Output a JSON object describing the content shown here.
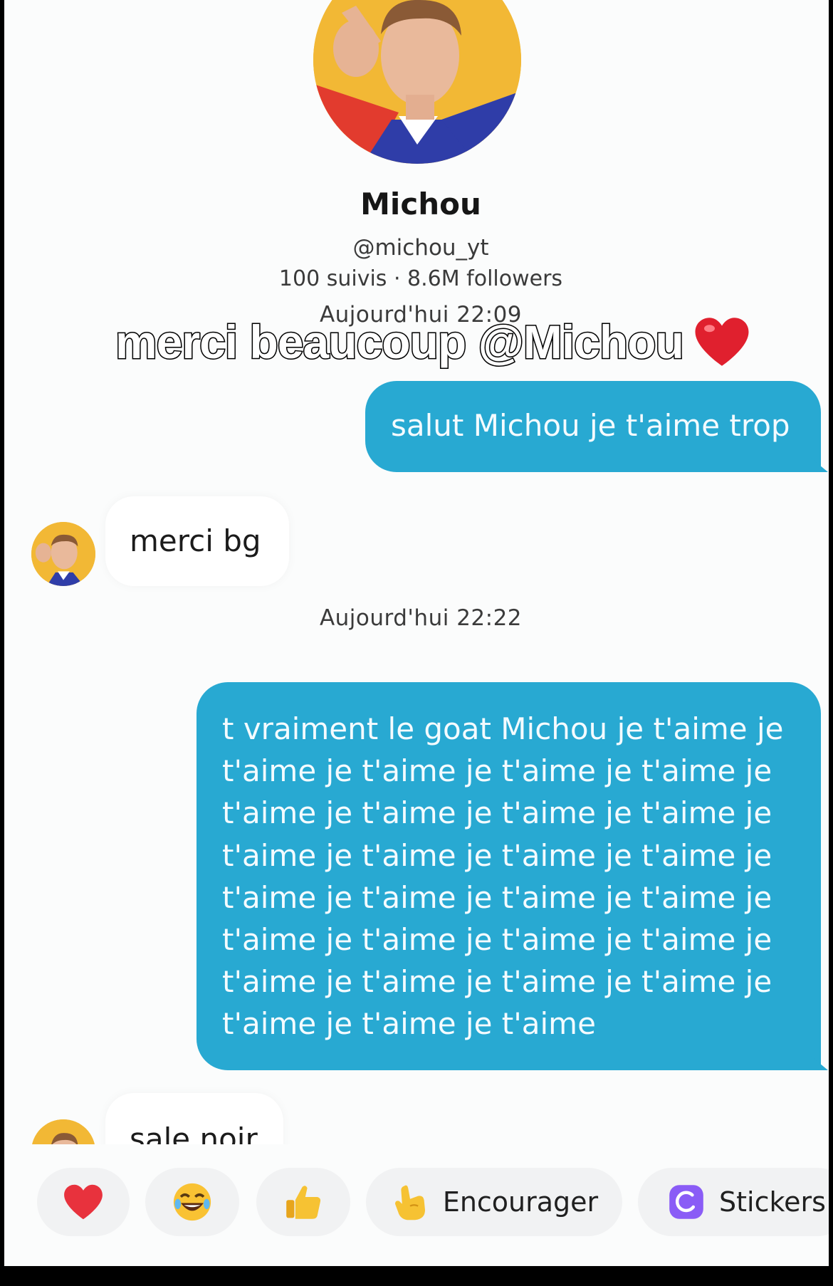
{
  "profile": {
    "name": "Michou",
    "handle": "@michou_yt",
    "stats": "100 suivis · 8.6M followers"
  },
  "overlay_caption": "merci beaucoup @Michou",
  "conversation": {
    "timestamp_1": "Aujourd'hui 22:09",
    "timestamp_2": "Aujourd'hui 22:22",
    "messages": [
      {
        "side": "sent",
        "text": "salut Michou je t'aime trop"
      },
      {
        "side": "received",
        "text": "merci bg"
      },
      {
        "side": "sent",
        "text": "t vraiment le goat Michou je t'aime je t'aime je t'aime je t'aime je t'aime je t'aime je t'aime je t'aime je t'aime je t'aime je t'aime je t'aime je t'aime je t'aime je t'aime je t'aime je t'aime je t'aime je t'aime je t'aime je t'aime je t'aime je t'aime je t'aime je t'aime je t'aime je t'aime je t'aime"
      },
      {
        "side": "received",
        "text": "sale noir"
      }
    ]
  },
  "quick_replies": {
    "heart": "heart-icon",
    "laugh": "laughing-emoji-icon",
    "thumb": "thumbs-up-icon",
    "encourage_label": "Encourager",
    "stickers_label": "Stickers"
  },
  "colors": {
    "sent_bubble": "#28a9d2",
    "received_bubble": "#ffffff",
    "background": "#fbfcfc"
  }
}
